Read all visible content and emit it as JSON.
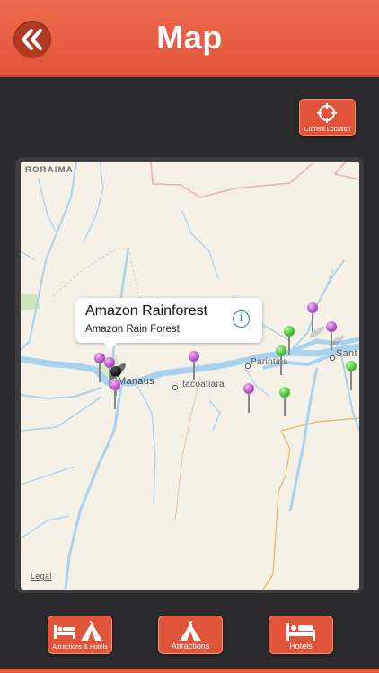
{
  "header": {
    "title": "Map"
  },
  "current_location": {
    "label": "Current Location"
  },
  "map": {
    "region_label": "RORAIMA",
    "place_labels": {
      "manaus": "Manaus",
      "itacoatiara": "Itacoatiara",
      "parintins": "Parintins",
      "santarem": "Sant"
    },
    "legal_label": "Legal",
    "callout": {
      "title": "Amazon Rainforest",
      "subtitle": "Amazon Rain Forest"
    }
  },
  "tabs": [
    {
      "label": "Attractions & Hotels"
    },
    {
      "label": "Attractions"
    },
    {
      "label": "Hotels"
    }
  ],
  "colors": {
    "accent": "#e2553a",
    "background": "#2b2b2d",
    "pin_purple": "#b24bc4",
    "pin_green": "#3ec02c"
  }
}
